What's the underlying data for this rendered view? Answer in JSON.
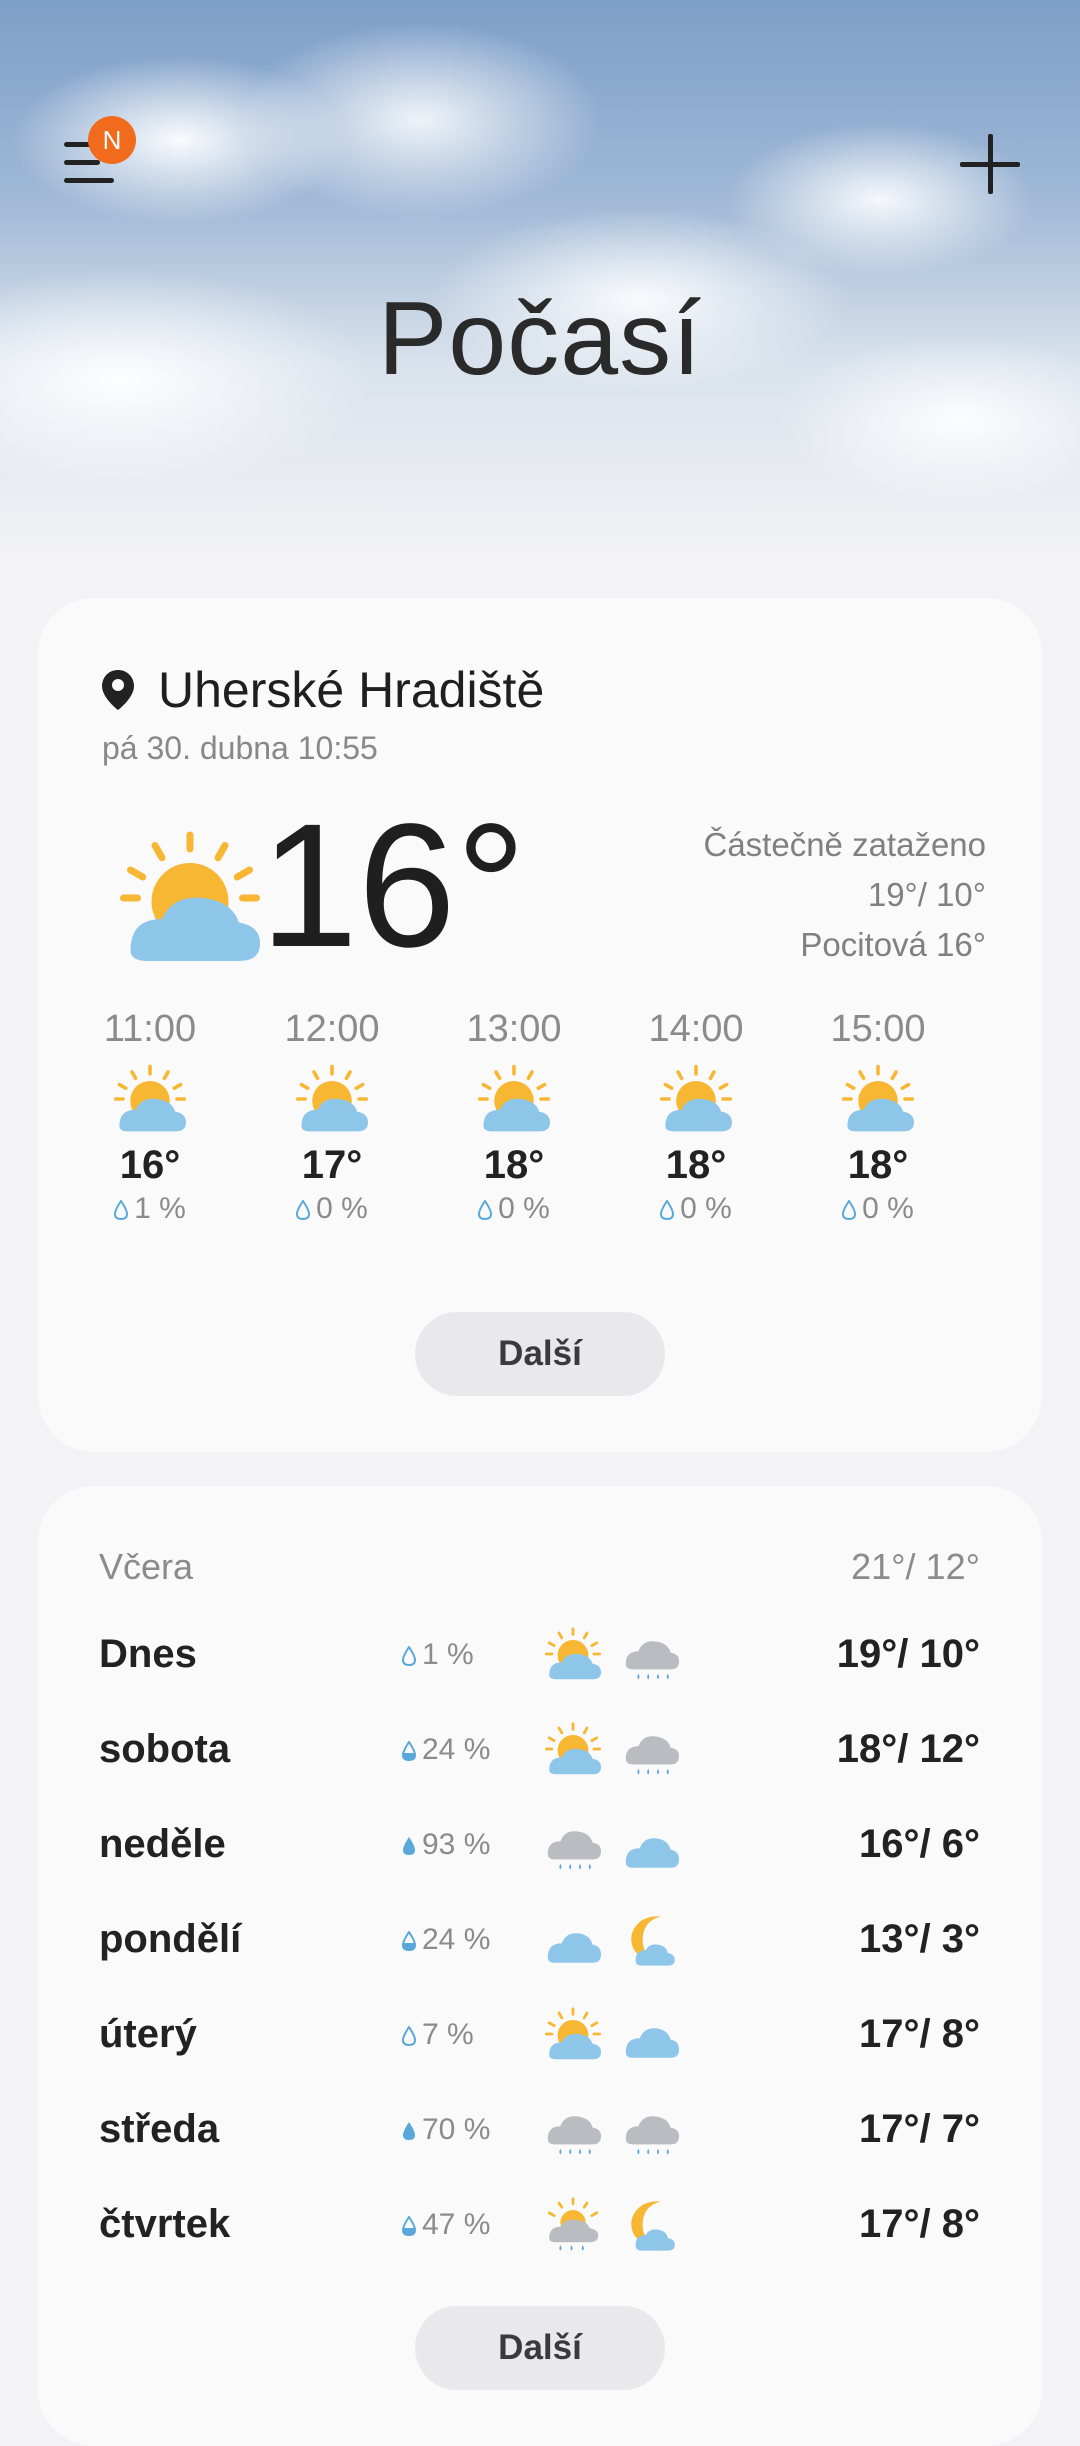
{
  "header": {
    "title": "Počasí",
    "menu_icon": "hamburger-menu-icon",
    "badge_text": "N",
    "add_icon": "plus-icon"
  },
  "current": {
    "location": "Uherské Hradiště",
    "datetime": "pá 30. dubna 10:55",
    "temperature": "16°",
    "condition": "Částečně zataženo",
    "high_low": "19°/ 10°",
    "feels_like": "Pocitová 16°",
    "icon": "partly-cloudy-icon"
  },
  "hourly": [
    {
      "time": "11:00",
      "temp": "16°",
      "rain": "1 %",
      "icon": "partly-cloudy-icon"
    },
    {
      "time": "12:00",
      "temp": "17°",
      "rain": "0 %",
      "icon": "partly-cloudy-icon"
    },
    {
      "time": "13:00",
      "temp": "18°",
      "rain": "0 %",
      "icon": "partly-cloudy-icon"
    },
    {
      "time": "14:00",
      "temp": "18°",
      "rain": "0 %",
      "icon": "partly-cloudy-icon"
    },
    {
      "time": "15:00",
      "temp": "18°",
      "rain": "0 %",
      "icon": "partly-cloudy-icon"
    }
  ],
  "hourly_more_label": "Další",
  "daily": {
    "yesterday_label": "Včera",
    "yesterday_temps": "21°/ 12°",
    "rows": [
      {
        "day": "Dnes",
        "rain": "1 %",
        "icon_day": "partly-cloudy-icon",
        "icon_night": "rain-cloud-icon",
        "temps": "19°/ 10°"
      },
      {
        "day": "sobota",
        "rain": "24 %",
        "icon_day": "partly-cloudy-icon",
        "icon_night": "rain-cloud-icon",
        "temps": "18°/ 12°"
      },
      {
        "day": "neděle",
        "rain": "93 %",
        "icon_day": "rain-cloud-icon",
        "icon_night": "cloud-icon",
        "temps": "16°/ 6°"
      },
      {
        "day": "pondělí",
        "rain": "24 %",
        "icon_day": "cloud-icon",
        "icon_night": "moon-cloud-icon",
        "temps": "13°/ 3°"
      },
      {
        "day": "úterý",
        "rain": "7 %",
        "icon_day": "partly-cloudy-icon",
        "icon_night": "cloud-icon",
        "temps": "17°/ 8°"
      },
      {
        "day": "středa",
        "rain": "70 %",
        "icon_day": "rain-cloud-icon",
        "icon_night": "rain-cloud-icon",
        "temps": "17°/ 7°"
      },
      {
        "day": "čtvrtek",
        "rain": "47 %",
        "icon_day": "sun-rain-cloud-icon",
        "icon_night": "moon-cloud-icon",
        "temps": "17°/ 8°"
      }
    ],
    "more_label": "Další"
  },
  "colors": {
    "sun": "#f7b733",
    "cloud_blue": "#8ec6ea",
    "rain_cloud": "#b9bcc0",
    "drop": "#5aa7dc",
    "badge": "#f26a1b"
  }
}
